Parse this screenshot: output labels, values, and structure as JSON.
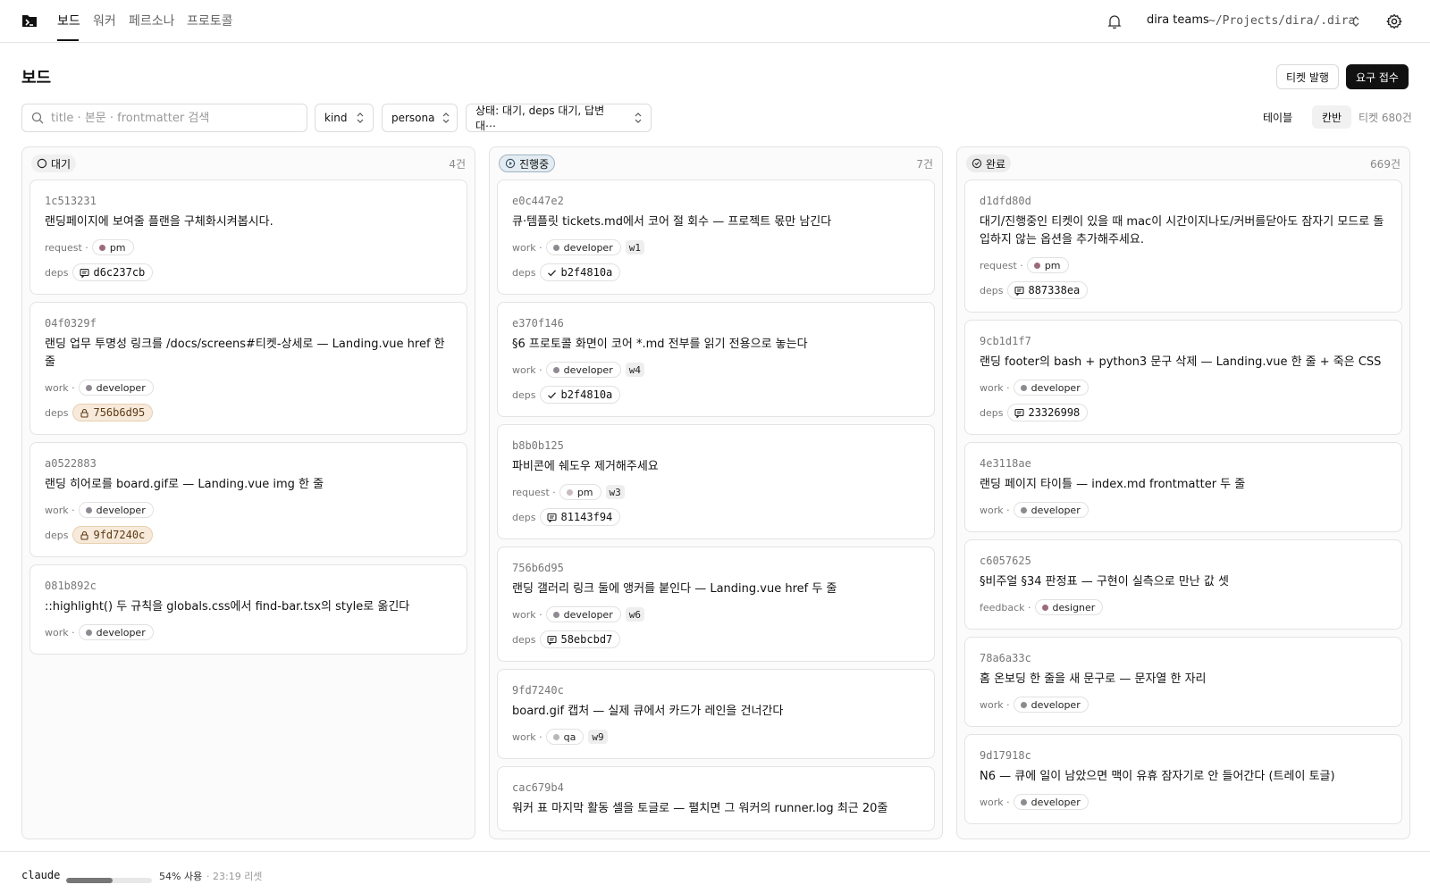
{
  "nav": {
    "tabs": [
      {
        "label": "보드",
        "active": true
      },
      {
        "label": "워커",
        "active": false
      },
      {
        "label": "페르소나",
        "active": false
      },
      {
        "label": "프로토콜",
        "active": false
      }
    ],
    "workspace_name": "dira teams",
    "workspace_path": "~/Projects/dira/.dira"
  },
  "header": {
    "title": "보드",
    "issue_ticket_label": "티켓 발행",
    "request_intake_label": "요구 접수"
  },
  "filters": {
    "search_placeholder": "title · 본문 · frontmatter 검색",
    "search_value": "",
    "kind_label": "kind",
    "persona_label": "persona",
    "status_label": "상태: 대기, deps 대기, 답변 대⋯"
  },
  "view": {
    "table_label": "테이블",
    "kanban_label": "칸반",
    "ticket_count": "티켓 680건"
  },
  "colors": {
    "dot_pm": "#9b6b7a",
    "dot_pm_light": "#c9bbbf",
    "dot_developer": "#8f8a91",
    "dot_designer": "#9b6b7a",
    "dot_qa": "#b8b6b9",
    "in_progress_badge": "#e3ecf2",
    "locked_dep_bg": "#f7eadb"
  },
  "columns": [
    {
      "title": "대기",
      "count": "4건",
      "icon": "circle-icon",
      "cards": [
        {
          "id": "1c513231",
          "title": "랜딩페이지에 보여줄 플랜을 구체화시켜봅시다.",
          "kind": "request ·",
          "persona": "pm",
          "dot": "#9b6b7a",
          "w": "",
          "dep": "d6c237cb",
          "dep_icon": "comment",
          "dep_locked": false
        },
        {
          "id": "04f0329f",
          "title": "랜딩 업무 투명성 링크를 /docs/screens#티켓-상세로 — Landing.vue href 한 줄",
          "kind": "work ·",
          "persona": "developer",
          "dot": "#8f8a91",
          "w": "",
          "dep": "756b6d95",
          "dep_icon": "lock",
          "dep_locked": true
        },
        {
          "id": "a0522883",
          "title": "랜딩 히어로를 board.gif로 — Landing.vue img 한 줄",
          "kind": "work ·",
          "persona": "developer",
          "dot": "#8f8a91",
          "w": "",
          "dep": "9fd7240c",
          "dep_icon": "lock",
          "dep_locked": true
        },
        {
          "id": "081b892c",
          "title": "::highlight() 두 규칙을 globals.css에서 find-bar.tsx의 style로 옮긴다",
          "kind": "work ·",
          "persona": "developer",
          "dot": "#8f8a91",
          "w": "",
          "dep": "",
          "dep_icon": "",
          "dep_locked": false
        }
      ]
    },
    {
      "title": "진행중",
      "count": "7건",
      "icon": "play-circle-icon",
      "cards": [
        {
          "id": "e0c447e2",
          "title": "큐·템플릿 tickets.md에서 코어 절 회수 — 프로젝트 몫만 남긴다",
          "kind": "work ·",
          "persona": "developer",
          "dot": "#8f8a91",
          "w": "w1",
          "dep": "b2f4810a",
          "dep_icon": "check",
          "dep_locked": false
        },
        {
          "id": "e370f146",
          "title": "§6 프로토콜 화면이 코어 *.md 전부를 읽기 전용으로 놓는다",
          "kind": "work ·",
          "persona": "developer",
          "dot": "#8f8a91",
          "w": "w4",
          "dep": "b2f4810a",
          "dep_icon": "check",
          "dep_locked": false
        },
        {
          "id": "b8b0b125",
          "title": "파비콘에 쉐도우 제거해주세요",
          "kind": "request ·",
          "persona": "pm",
          "dot": "#c9bbbf",
          "w": "w3",
          "dep": "81143f94",
          "dep_icon": "comment",
          "dep_locked": false
        },
        {
          "id": "756b6d95",
          "title": "랜딩 갤러리 링크 둘에 앵커를 붙인다 — Landing.vue href 두 줄",
          "kind": "work ·",
          "persona": "developer",
          "dot": "#8f8a91",
          "w": "w6",
          "dep": "58ebcbd7",
          "dep_icon": "comment",
          "dep_locked": false
        },
        {
          "id": "9fd7240c",
          "title": "board.gif 캡처 — 실제 큐에서 카드가 레인을 건너간다",
          "kind": "work ·",
          "persona": "qa",
          "dot": "#b8b6b9",
          "w": "w9",
          "dep": "",
          "dep_icon": "",
          "dep_locked": false
        },
        {
          "id": "cac679b4",
          "title": "워커 표 마지막 활동 셀을 토글로 — 펼치면 그 워커의 runner.log 최근 20줄",
          "kind": "",
          "persona": "",
          "dot": "",
          "w": "",
          "dep": "",
          "dep_icon": "",
          "dep_locked": false
        }
      ]
    },
    {
      "title": "완료",
      "count": "669건",
      "icon": "check-circle-icon",
      "cards": [
        {
          "id": "d1dfd80d",
          "title": "대기/진행중인 티켓이 있을 때 mac이 시간이지나도/커버를닫아도 잠자기 모드로 돌입하지 않는 옵션을 추가해주세요.",
          "kind": "request ·",
          "persona": "pm",
          "dot": "#9b6b7a",
          "w": "",
          "dep": "887338ea",
          "dep_icon": "comment",
          "dep_locked": false
        },
        {
          "id": "9cb1d1f7",
          "title": "랜딩 footer의 bash + python3 문구 삭제 — Landing.vue 한 줄 + 죽은 CSS",
          "kind": "work ·",
          "persona": "developer",
          "dot": "#8f8a91",
          "w": "",
          "dep": "23326998",
          "dep_icon": "comment",
          "dep_locked": false
        },
        {
          "id": "4e3118ae",
          "title": "랜딩 페이지 타이틀 — index.md frontmatter 두 줄",
          "kind": "work ·",
          "persona": "developer",
          "dot": "#8f8a91",
          "w": "",
          "dep": "",
          "dep_icon": "",
          "dep_locked": false
        },
        {
          "id": "c6057625",
          "title": "§비주얼 §34 판정표 — 구현이 실측으로 만난 값 셋",
          "kind": "feedback ·",
          "persona": "designer",
          "dot": "#9b6b7a",
          "w": "",
          "dep": "",
          "dep_icon": "",
          "dep_locked": false
        },
        {
          "id": "78a6a33c",
          "title": "홈 온보딩 한 줄을 새 문구로 — 문자열 한 자리",
          "kind": "work ·",
          "persona": "developer",
          "dot": "#8f8a91",
          "w": "",
          "dep": "",
          "dep_icon": "",
          "dep_locked": false
        },
        {
          "id": "9d17918c",
          "title": "N6 — 큐에 일이 남았으면 맥이 유휴 잠자기로 안 들어간다 (트레이 토글)",
          "kind": "work ·",
          "persona": "developer",
          "dot": "#8f8a91",
          "w": "",
          "dep": "",
          "dep_icon": "",
          "dep_locked": false
        }
      ]
    }
  ],
  "deps_label": "deps",
  "footer": {
    "agent": "claude",
    "usage_fraction": 0.54,
    "usage_text": "54% 사용",
    "reset_text": "· 23:19 리셋"
  }
}
